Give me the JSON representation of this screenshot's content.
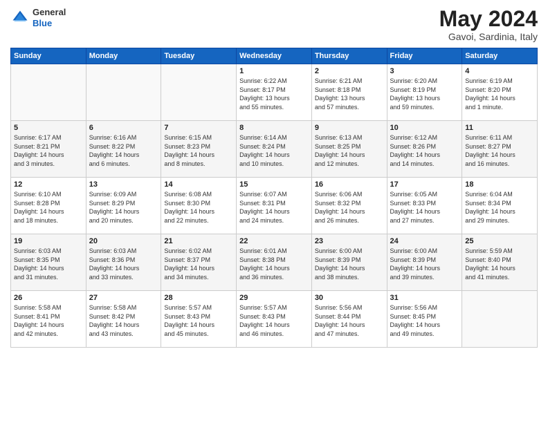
{
  "header": {
    "logo_general": "General",
    "logo_blue": "Blue",
    "month": "May 2024",
    "location": "Gavoi, Sardinia, Italy"
  },
  "days_of_week": [
    "Sunday",
    "Monday",
    "Tuesday",
    "Wednesday",
    "Thursday",
    "Friday",
    "Saturday"
  ],
  "weeks": [
    [
      {
        "day": "",
        "info": ""
      },
      {
        "day": "",
        "info": ""
      },
      {
        "day": "",
        "info": ""
      },
      {
        "day": "1",
        "info": "Sunrise: 6:22 AM\nSunset: 8:17 PM\nDaylight: 13 hours\nand 55 minutes."
      },
      {
        "day": "2",
        "info": "Sunrise: 6:21 AM\nSunset: 8:18 PM\nDaylight: 13 hours\nand 57 minutes."
      },
      {
        "day": "3",
        "info": "Sunrise: 6:20 AM\nSunset: 8:19 PM\nDaylight: 13 hours\nand 59 minutes."
      },
      {
        "day": "4",
        "info": "Sunrise: 6:19 AM\nSunset: 8:20 PM\nDaylight: 14 hours\nand 1 minute."
      }
    ],
    [
      {
        "day": "5",
        "info": "Sunrise: 6:17 AM\nSunset: 8:21 PM\nDaylight: 14 hours\nand 3 minutes."
      },
      {
        "day": "6",
        "info": "Sunrise: 6:16 AM\nSunset: 8:22 PM\nDaylight: 14 hours\nand 6 minutes."
      },
      {
        "day": "7",
        "info": "Sunrise: 6:15 AM\nSunset: 8:23 PM\nDaylight: 14 hours\nand 8 minutes."
      },
      {
        "day": "8",
        "info": "Sunrise: 6:14 AM\nSunset: 8:24 PM\nDaylight: 14 hours\nand 10 minutes."
      },
      {
        "day": "9",
        "info": "Sunrise: 6:13 AM\nSunset: 8:25 PM\nDaylight: 14 hours\nand 12 minutes."
      },
      {
        "day": "10",
        "info": "Sunrise: 6:12 AM\nSunset: 8:26 PM\nDaylight: 14 hours\nand 14 minutes."
      },
      {
        "day": "11",
        "info": "Sunrise: 6:11 AM\nSunset: 8:27 PM\nDaylight: 14 hours\nand 16 minutes."
      }
    ],
    [
      {
        "day": "12",
        "info": "Sunrise: 6:10 AM\nSunset: 8:28 PM\nDaylight: 14 hours\nand 18 minutes."
      },
      {
        "day": "13",
        "info": "Sunrise: 6:09 AM\nSunset: 8:29 PM\nDaylight: 14 hours\nand 20 minutes."
      },
      {
        "day": "14",
        "info": "Sunrise: 6:08 AM\nSunset: 8:30 PM\nDaylight: 14 hours\nand 22 minutes."
      },
      {
        "day": "15",
        "info": "Sunrise: 6:07 AM\nSunset: 8:31 PM\nDaylight: 14 hours\nand 24 minutes."
      },
      {
        "day": "16",
        "info": "Sunrise: 6:06 AM\nSunset: 8:32 PM\nDaylight: 14 hours\nand 26 minutes."
      },
      {
        "day": "17",
        "info": "Sunrise: 6:05 AM\nSunset: 8:33 PM\nDaylight: 14 hours\nand 27 minutes."
      },
      {
        "day": "18",
        "info": "Sunrise: 6:04 AM\nSunset: 8:34 PM\nDaylight: 14 hours\nand 29 minutes."
      }
    ],
    [
      {
        "day": "19",
        "info": "Sunrise: 6:03 AM\nSunset: 8:35 PM\nDaylight: 14 hours\nand 31 minutes."
      },
      {
        "day": "20",
        "info": "Sunrise: 6:03 AM\nSunset: 8:36 PM\nDaylight: 14 hours\nand 33 minutes."
      },
      {
        "day": "21",
        "info": "Sunrise: 6:02 AM\nSunset: 8:37 PM\nDaylight: 14 hours\nand 34 minutes."
      },
      {
        "day": "22",
        "info": "Sunrise: 6:01 AM\nSunset: 8:38 PM\nDaylight: 14 hours\nand 36 minutes."
      },
      {
        "day": "23",
        "info": "Sunrise: 6:00 AM\nSunset: 8:39 PM\nDaylight: 14 hours\nand 38 minutes."
      },
      {
        "day": "24",
        "info": "Sunrise: 6:00 AM\nSunset: 8:39 PM\nDaylight: 14 hours\nand 39 minutes."
      },
      {
        "day": "25",
        "info": "Sunrise: 5:59 AM\nSunset: 8:40 PM\nDaylight: 14 hours\nand 41 minutes."
      }
    ],
    [
      {
        "day": "26",
        "info": "Sunrise: 5:58 AM\nSunset: 8:41 PM\nDaylight: 14 hours\nand 42 minutes."
      },
      {
        "day": "27",
        "info": "Sunrise: 5:58 AM\nSunset: 8:42 PM\nDaylight: 14 hours\nand 43 minutes."
      },
      {
        "day": "28",
        "info": "Sunrise: 5:57 AM\nSunset: 8:43 PM\nDaylight: 14 hours\nand 45 minutes."
      },
      {
        "day": "29",
        "info": "Sunrise: 5:57 AM\nSunset: 8:43 PM\nDaylight: 14 hours\nand 46 minutes."
      },
      {
        "day": "30",
        "info": "Sunrise: 5:56 AM\nSunset: 8:44 PM\nDaylight: 14 hours\nand 47 minutes."
      },
      {
        "day": "31",
        "info": "Sunrise: 5:56 AM\nSunset: 8:45 PM\nDaylight: 14 hours\nand 49 minutes."
      },
      {
        "day": "",
        "info": ""
      }
    ]
  ]
}
